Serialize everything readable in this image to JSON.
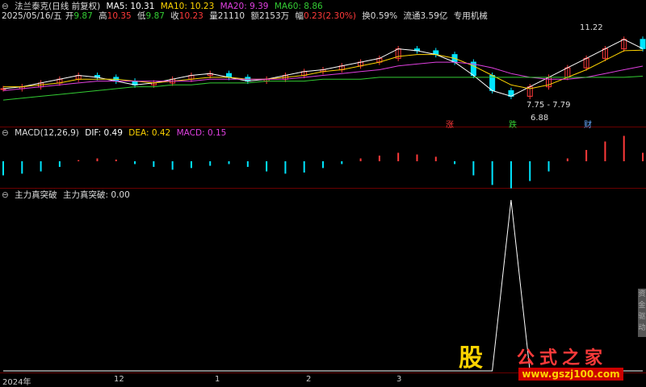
{
  "header": {
    "title": "法兰泰克(日线 前复权)",
    "ma": [
      {
        "label": "MA5: 10.31",
        "color": "#ffffff"
      },
      {
        "label": "MA10: 10.23",
        "color": "#ffd400"
      },
      {
        "label": "MA20: 9.39",
        "color": "#e040e0"
      },
      {
        "label": "MA60: 8.86",
        "color": "#33cc33"
      }
    ]
  },
  "quote": {
    "date": "2025/05/16/五",
    "open_label": "开",
    "open": "9.87",
    "high_label": "高",
    "high": "10.35",
    "low_label": "低",
    "low": "9.87",
    "close_label": "收",
    "close": "10.23",
    "vol_label": "量",
    "vol": "21110",
    "amt_label": "额",
    "amt": "2153万",
    "chg_label": "幅",
    "chg": "0.23(2.30%)",
    "turnover": "换0.59%",
    "float": "流通3.59亿",
    "sector": "专用机械"
  },
  "annotations": {
    "high": "11.22",
    "range": "7.75 - 7.79",
    "low": "6.88",
    "tag_up": "涨",
    "tag_down": "跌",
    "tag_fin": "财"
  },
  "macd_header": {
    "title": "MACD(12,26,9)",
    "dif": "DIF: 0.49",
    "dea": "DEA: 0.42",
    "macd": "MACD: 0.15"
  },
  "indicator_header": {
    "title": "主力真突破",
    "value": "主力真突破: 0.00"
  },
  "x_ticks": [
    "2024年",
    "12",
    "1",
    "2",
    "3"
  ],
  "side_panel": [
    "资",
    "金",
    "驱",
    "动"
  ],
  "watermark": {
    "logo": "股",
    "site_name": "公式之家",
    "url": "www.gszj100.com"
  },
  "colors": {
    "up": "#ff3a3a",
    "down": "#00e5ff",
    "ma5": "#ffffff",
    "ma10": "#ffd400",
    "ma20": "#e040e0",
    "ma60": "#33cc33",
    "separator": "#6a0000"
  },
  "chart_data": [
    {
      "type": "candlestick",
      "name": "price",
      "series": [
        {
          "name": "MA5",
          "values": [
            8.2,
            8.3,
            8.5,
            8.7,
            8.9,
            8.8,
            8.6,
            8.4,
            8.5,
            8.7,
            8.9,
            9.0,
            8.8,
            8.6,
            8.7,
            8.9,
            9.1,
            9.2,
            9.4,
            9.6,
            9.8,
            10.3,
            10.2,
            10.0,
            9.6,
            8.9,
            8.1,
            7.8,
            8.3,
            8.8,
            9.3,
            9.8,
            10.3,
            10.8,
            10.31
          ]
        },
        {
          "name": "MA10",
          "values": [
            8.3,
            8.3,
            8.4,
            8.5,
            8.7,
            8.7,
            8.7,
            8.6,
            8.5,
            8.6,
            8.7,
            8.8,
            8.8,
            8.7,
            8.7,
            8.8,
            8.9,
            9.1,
            9.2,
            9.4,
            9.6,
            9.9,
            10.0,
            10.0,
            9.8,
            9.4,
            8.9,
            8.4,
            8.2,
            8.4,
            8.8,
            9.2,
            9.7,
            10.2,
            10.23
          ]
        },
        {
          "name": "MA20",
          "values": [
            8.1,
            8.2,
            8.3,
            8.4,
            8.5,
            8.6,
            8.6,
            8.6,
            8.6,
            8.6,
            8.6,
            8.7,
            8.7,
            8.7,
            8.7,
            8.7,
            8.8,
            8.9,
            9.0,
            9.1,
            9.2,
            9.4,
            9.5,
            9.6,
            9.6,
            9.5,
            9.3,
            9.0,
            8.8,
            8.7,
            8.7,
            8.8,
            9.0,
            9.2,
            9.39
          ]
        },
        {
          "name": "MA60",
          "values": [
            7.6,
            7.7,
            7.8,
            7.9,
            8.0,
            8.1,
            8.2,
            8.3,
            8.3,
            8.4,
            8.4,
            8.5,
            8.5,
            8.5,
            8.6,
            8.6,
            8.6,
            8.7,
            8.7,
            8.7,
            8.8,
            8.8,
            8.8,
            8.8,
            8.8,
            8.8,
            8.8,
            8.8,
            8.8,
            8.8,
            8.8,
            8.8,
            8.8,
            8.8,
            8.86
          ]
        }
      ],
      "high": 11.22,
      "low": 6.88
    },
    {
      "type": "bar",
      "name": "MACD",
      "values": [
        -0.25,
        -0.22,
        -0.18,
        -0.1,
        0.02,
        0.05,
        0.03,
        -0.05,
        -0.1,
        -0.15,
        -0.12,
        -0.08,
        -0.05,
        -0.1,
        -0.18,
        -0.22,
        -0.2,
        -0.12,
        -0.05,
        0.05,
        0.1,
        0.15,
        0.12,
        0.08,
        -0.05,
        -0.25,
        -0.42,
        -0.48,
        -0.35,
        -0.18,
        0.05,
        0.2,
        0.35,
        0.45,
        0.15
      ]
    },
    {
      "type": "line",
      "name": "主力真突破",
      "values": [
        0,
        0,
        0,
        0,
        0,
        0,
        0,
        0,
        0,
        0,
        0,
        0,
        0,
        0,
        0,
        0,
        0,
        0,
        0,
        0,
        0,
        0,
        0,
        0,
        0,
        0,
        0,
        1,
        0,
        0,
        0,
        0,
        0,
        0,
        0
      ]
    }
  ]
}
